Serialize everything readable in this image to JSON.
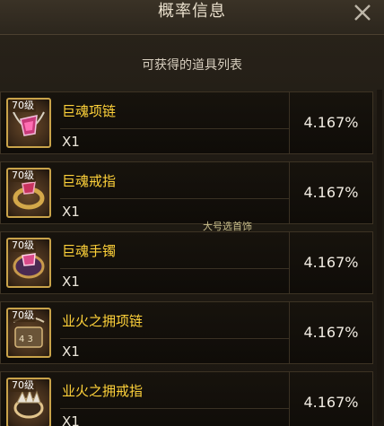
{
  "window": {
    "title": "概率信息",
    "close_icon": "close-icon"
  },
  "list_title": "可获得的道具列表",
  "items": [
    {
      "level": "70级",
      "name": "巨魂项链",
      "qty": "X1",
      "rate": "4.167%",
      "icon": "necklace-icon"
    },
    {
      "level": "70级",
      "name": "巨魂戒指",
      "qty": "X1",
      "rate": "4.167%",
      "icon": "ring-icon"
    },
    {
      "level": "70级",
      "name": "巨魂手镯",
      "qty": "X1",
      "rate": "4.167%",
      "icon": "bracelet-icon"
    },
    {
      "level": "70级",
      "name": "业火之拥项链",
      "qty": "X1",
      "rate": "4.167%",
      "icon": "necklace-icon"
    },
    {
      "level": "70级",
      "name": "业火之拥戒指",
      "qty": "X1",
      "rate": "4.167%",
      "icon": "ring-icon"
    }
  ],
  "watermark": "大号选首饰",
  "colors": {
    "item_name": "#ffd23a",
    "frame_gold": "#c9a34a"
  }
}
